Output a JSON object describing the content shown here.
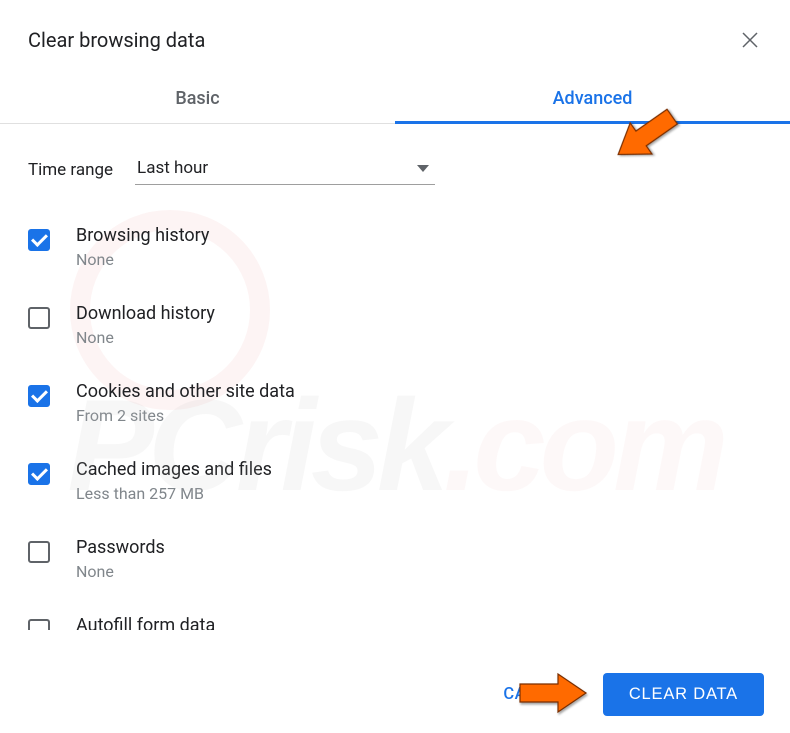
{
  "dialog": {
    "title": "Clear browsing data"
  },
  "tabs": {
    "basic": "Basic",
    "advanced": "Advanced"
  },
  "timeRange": {
    "label": "Time range",
    "value": "Last hour"
  },
  "items": [
    {
      "title": "Browsing history",
      "sub": "None",
      "checked": true
    },
    {
      "title": "Download history",
      "sub": "None",
      "checked": false
    },
    {
      "title": "Cookies and other site data",
      "sub": "From 2 sites",
      "checked": true
    },
    {
      "title": "Cached images and files",
      "sub": "Less than 257 MB",
      "checked": true
    },
    {
      "title": "Passwords",
      "sub": "None",
      "checked": false
    },
    {
      "title": "Autofill form data",
      "sub": "",
      "checked": false
    }
  ],
  "footer": {
    "cancel": "CANCEL",
    "clear": "CLEAR DATA"
  }
}
